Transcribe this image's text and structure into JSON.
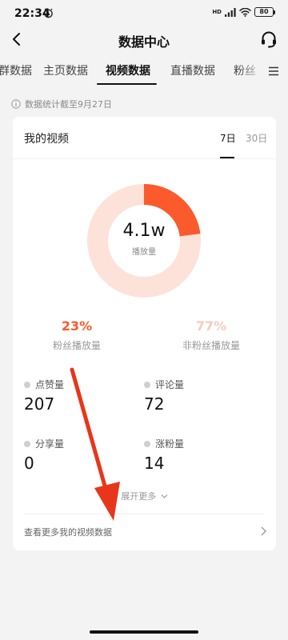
{
  "status_bar": {
    "time": "22:34",
    "network": "HD",
    "battery": "80"
  },
  "nav": {
    "title": "数据中心"
  },
  "tabs": [
    "群数据",
    "主页数据",
    "视频数据",
    "直播数据",
    "粉丝"
  ],
  "info": {
    "text": "数据统计截至9月27日"
  },
  "card": {
    "title": "我的视频",
    "periods": [
      "7日",
      "30日"
    ],
    "donut": {
      "value": "4.1w",
      "label": "播放量",
      "fan_share": 0.23
    },
    "fan_pct": {
      "value": "23%",
      "label": "粉丝播放量"
    },
    "nonfan_pct": {
      "value": "77%",
      "label": "非粉丝播放量"
    },
    "stats": [
      {
        "label": "点赞量",
        "value": "207"
      },
      {
        "label": "评论量",
        "value": "72"
      },
      {
        "label": "分享量",
        "value": "0"
      },
      {
        "label": "涨粉量",
        "value": "14"
      }
    ],
    "expand": "展开更多",
    "more_link": "查看更多我的视频数据"
  },
  "colors": {
    "accent": "#fa5a2c",
    "accent_light": "#fde2d9",
    "nonfan_text": "#f7cbbd"
  }
}
